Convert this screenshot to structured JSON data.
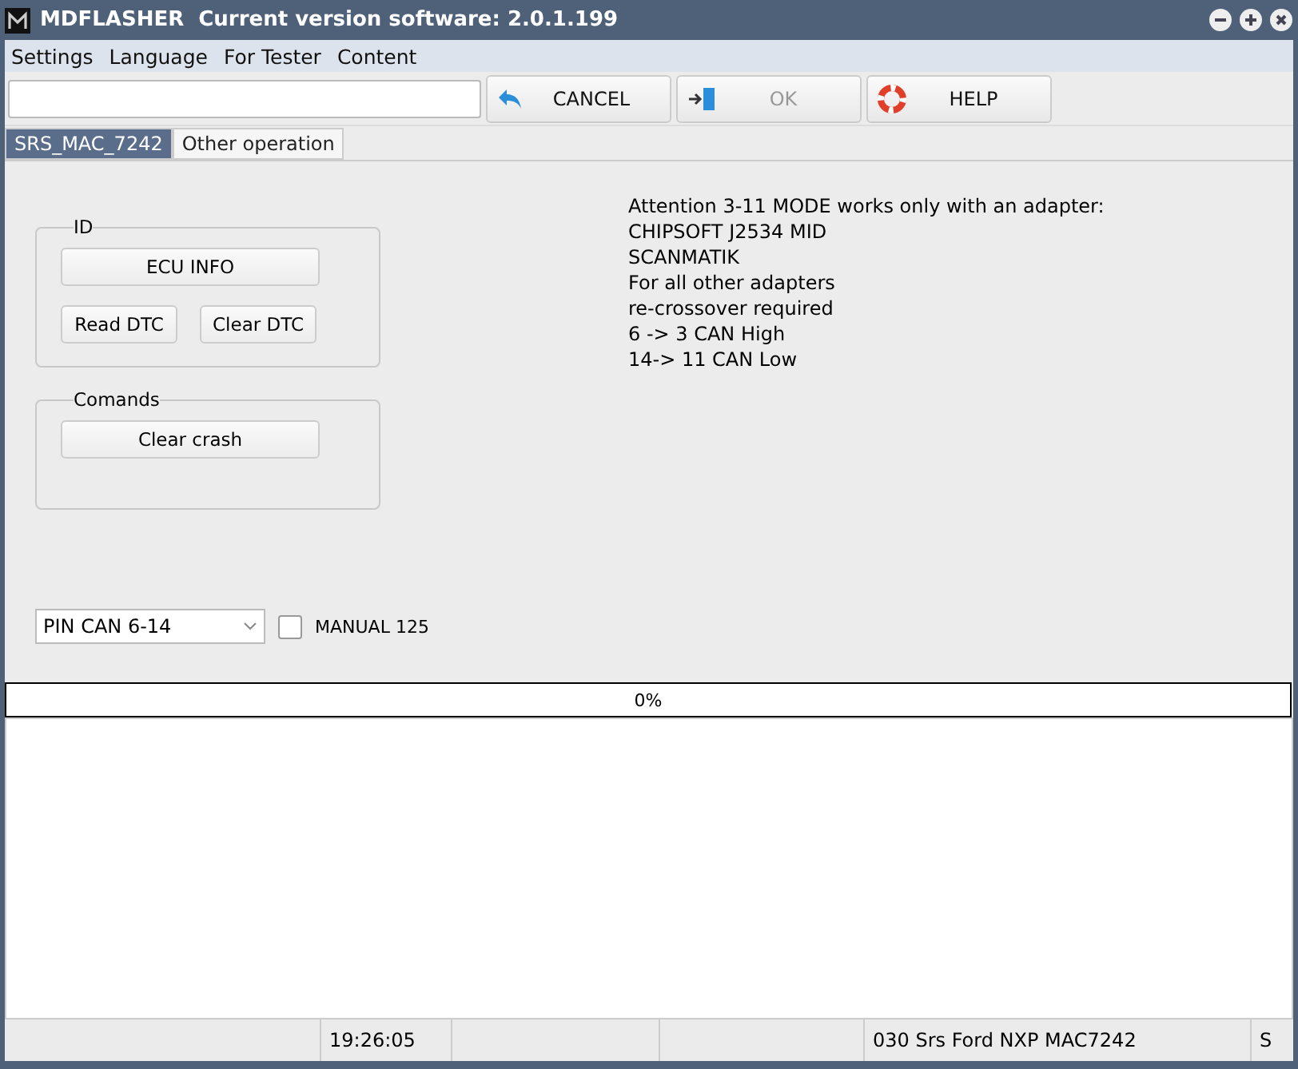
{
  "window": {
    "title": "MDFLASHER  Current version software: 2.0.1.199"
  },
  "menu": [
    "Settings",
    "Language",
    "For Tester",
    "Content"
  ],
  "toolbar": {
    "buttons": [
      {
        "kind": "cancel",
        "label": "CANCEL",
        "disabled": false
      },
      {
        "kind": "ok",
        "label": "OK",
        "disabled": true
      },
      {
        "kind": "help",
        "label": "HELP",
        "disabled": false
      }
    ]
  },
  "tabs": [
    {
      "label": "SRS_MAC_7242",
      "selected": true
    },
    {
      "label": "Other operation",
      "selected": false
    }
  ],
  "groups": [
    {
      "title": "ID",
      "rows": [
        [
          {
            "label": "ECU INFO",
            "wide": true
          }
        ],
        [
          {
            "label": "Read DTC",
            "wide": false
          },
          {
            "label": "Clear DTC",
            "wide": false
          }
        ]
      ]
    },
    {
      "title": "Comands",
      "rows": [
        [
          {
            "label": "Clear crash",
            "wide": true
          }
        ]
      ]
    }
  ],
  "notes": [
    "Attention 3-11 MODE works only with an adapter:",
    "CHIPSOFT J2534 MID",
    "SCANMATIK",
    "For all other adapters",
    "re-crossover required",
    "6 -> 3 CAN High",
    "14-> 11 CAN Low"
  ],
  "pin_select": {
    "value": "PIN CAN 6-14"
  },
  "manual": {
    "label": "MANUAL 125",
    "checked": false
  },
  "progress": {
    "text": "0%",
    "level": 0
  },
  "status_bar": {
    "time": "19:26:05",
    "device": "030 Srs Ford NXP MAC7242",
    "last": "S"
  }
}
